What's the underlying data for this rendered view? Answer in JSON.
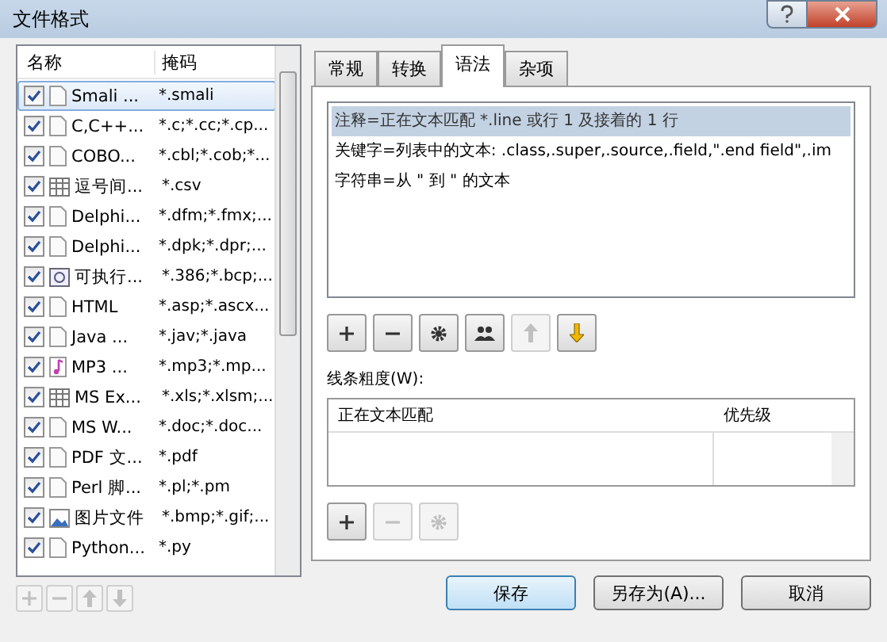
{
  "window": {
    "title": "文件格式"
  },
  "file_list": {
    "columns": [
      "名称",
      "掩码"
    ],
    "rows": [
      {
        "kind": "document",
        "name": "Smali ...",
        "mask": "*.smali",
        "checked": true,
        "selected": true
      },
      {
        "kind": "document",
        "name": "C,C++...",
        "mask": "*.c;*.cc;*.cp...",
        "checked": true,
        "selected": false
      },
      {
        "kind": "document",
        "name": "COBO...",
        "mask": "*.cbl;*.cob;*...",
        "checked": true,
        "selected": false
      },
      {
        "kind": "table",
        "name": "逗号间...",
        "mask": "*.csv",
        "checked": true,
        "selected": false
      },
      {
        "kind": "document",
        "name": "Delphi...",
        "mask": "*.dfm;*.fmx;...",
        "checked": true,
        "selected": false
      },
      {
        "kind": "document",
        "name": "Delphi...",
        "mask": "*.dpk;*.dpr;...",
        "checked": true,
        "selected": false
      },
      {
        "kind": "program",
        "name": "可执行...",
        "mask": "*.386;*.bcp;...",
        "checked": true,
        "selected": false
      },
      {
        "kind": "document",
        "name": "HTML",
        "mask": "*.asp;*.ascx...",
        "checked": true,
        "selected": false
      },
      {
        "kind": "document",
        "name": "Java ...",
        "mask": "*.jav;*.java",
        "checked": true,
        "selected": false
      },
      {
        "kind": "music",
        "name": "MP3 ...",
        "mask": "*.mp3;*.mp...",
        "checked": true,
        "selected": false
      },
      {
        "kind": "table",
        "name": "MS Ex...",
        "mask": "*.xls;*.xlsm;...",
        "checked": true,
        "selected": false
      },
      {
        "kind": "document",
        "name": "MS W...",
        "mask": "*.doc;*.doc...",
        "checked": true,
        "selected": false
      },
      {
        "kind": "document",
        "name": "PDF 文...",
        "mask": "*.pdf",
        "checked": true,
        "selected": false
      },
      {
        "kind": "document",
        "name": "Perl 脚...",
        "mask": "*.pl;*.pm",
        "checked": true,
        "selected": false
      },
      {
        "kind": "image",
        "name": "图片文件",
        "mask": "*.bmp;*.gif;...",
        "checked": true,
        "selected": false
      },
      {
        "kind": "document",
        "name": "Python...",
        "mask": "*.py",
        "checked": true,
        "selected": false
      }
    ]
  },
  "list_buttons": [
    {
      "kind": "plus",
      "disabled": true
    },
    {
      "kind": "minus",
      "disabled": true
    },
    {
      "kind": "up",
      "disabled": true
    },
    {
      "kind": "down",
      "disabled": true
    }
  ],
  "tabs": [
    {
      "label": "常规",
      "selected": false
    },
    {
      "label": "转换",
      "selected": false
    },
    {
      "label": "语法",
      "selected": true
    },
    {
      "label": "杂项",
      "selected": false
    }
  ],
  "syntax_rules": [
    {
      "text": "注释=正在文本匹配 *.line 或行 1 及接着的 1 行",
      "selected": true
    },
    {
      "text": "关键字=列表中的文本: .class,.super,.source,.field,\".end field\",.im",
      "selected": false
    },
    {
      "text": "字符串=从 \" 到 \" 的文本",
      "selected": false
    }
  ],
  "rule_buttons": [
    {
      "kind": "plus",
      "disabled": false
    },
    {
      "kind": "minus",
      "disabled": false
    },
    {
      "kind": "gear",
      "disabled": false
    },
    {
      "kind": "people",
      "disabled": false
    },
    {
      "kind": "up",
      "disabled": true
    },
    {
      "kind": "down",
      "disabled": false
    }
  ],
  "line_width": {
    "label": "线条粗度(W):",
    "columns": [
      "正在文本匹配",
      "优先级"
    ]
  },
  "match_buttons": [
    {
      "kind": "plus",
      "disabled": false
    },
    {
      "kind": "minus",
      "disabled": true
    },
    {
      "kind": "gear",
      "disabled": true
    }
  ],
  "buttons": [
    {
      "label": "保存",
      "default": true
    },
    {
      "label": "另存为(A)...",
      "default": false
    },
    {
      "label": "取消",
      "default": false
    }
  ]
}
